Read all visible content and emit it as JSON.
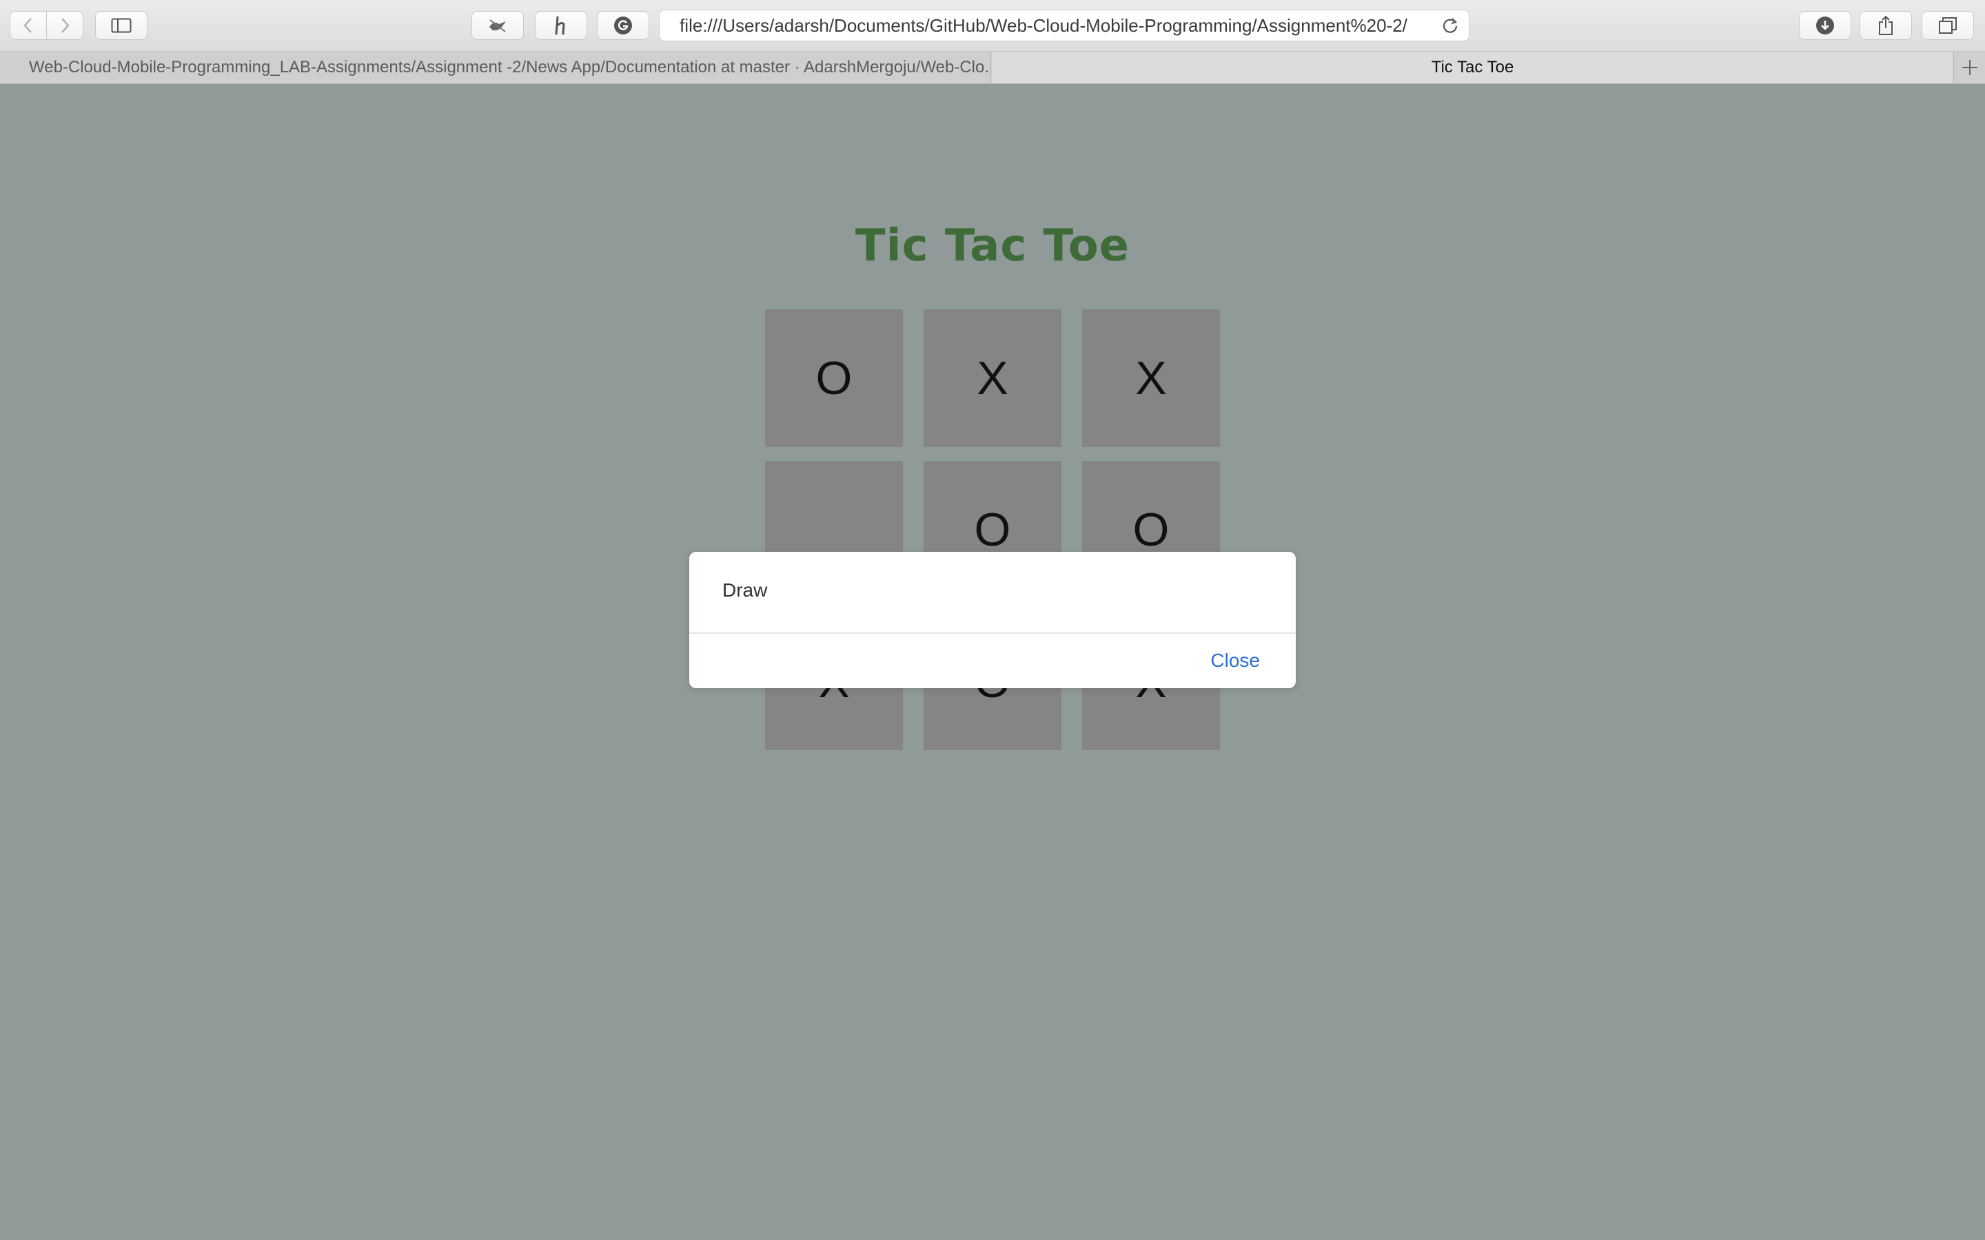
{
  "browser": {
    "url": "file:///Users/adarsh/Documents/GitHub/Web-Cloud-Mobile-Programming/Assignment%20-2/",
    "tabs": [
      {
        "label": "Web-Cloud-Mobile-Programming_LAB-Assignments/Assignment -2/News App/Documentation at master · AdarshMergoju/Web-Clo...",
        "active": false
      },
      {
        "label": "Tic Tac Toe",
        "active": true
      }
    ],
    "icons": {
      "back": "chevron-left-icon",
      "forward": "chevron-right-icon",
      "sidebar": "sidebar-icon",
      "extension1": "bird-icon",
      "extension2": "h-icon",
      "extension3": "grammarly-icon",
      "reload": "reload-icon",
      "downloads": "download-icon",
      "share": "share-icon",
      "tabs": "tabs-overview-icon",
      "new_tab": "plus-icon"
    }
  },
  "game": {
    "title": "Tic Tac Toe",
    "title_color": "#3e6b37",
    "board": [
      [
        "O",
        "X",
        "X"
      ],
      [
        "",
        "O",
        "O"
      ],
      [
        "X",
        "O",
        "X"
      ]
    ]
  },
  "modal": {
    "message": "Draw",
    "close_label": "Close",
    "link_color": "#2b6fd6"
  },
  "colors": {
    "page_background": "#8f9a99",
    "cell_background": "#858585"
  }
}
